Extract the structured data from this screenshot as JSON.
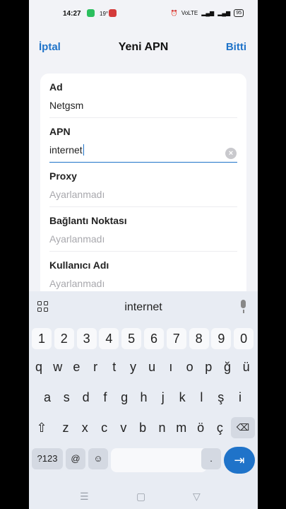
{
  "status_bar": {
    "time": "14:27",
    "temperature": "19°",
    "signal_text": "VoLTE",
    "battery": "95"
  },
  "nav": {
    "cancel_label": "İptal",
    "title": "Yeni APN",
    "done_label": "Bitti"
  },
  "fields": [
    {
      "label": "Ad",
      "value": "Netgsm",
      "placeholder": false
    },
    {
      "label": "APN",
      "value": "internet",
      "placeholder": false,
      "active": true
    },
    {
      "label": "Proxy",
      "value": "Ayarlanmadı",
      "placeholder": true
    },
    {
      "label": "Bağlantı Noktası",
      "value": "Ayarlanmadı",
      "placeholder": true
    },
    {
      "label": "Kullanıcı Adı",
      "value": "Ayarlanmadı",
      "placeholder": true
    }
  ],
  "keyboard": {
    "suggestion": "internet",
    "row_numbers": [
      "1",
      "2",
      "3",
      "4",
      "5",
      "6",
      "7",
      "8",
      "9",
      "0"
    ],
    "row1": [
      "q",
      "w",
      "e",
      "r",
      "t",
      "y",
      "u",
      "ı",
      "o",
      "p",
      "ğ",
      "ü"
    ],
    "row2": [
      "a",
      "s",
      "d",
      "f",
      "g",
      "h",
      "j",
      "k",
      "l",
      "ş",
      "i"
    ],
    "row3": [
      "z",
      "x",
      "c",
      "v",
      "b",
      "n",
      "m",
      "ö",
      "ç"
    ],
    "symbols_label": "?123",
    "at_label": "@",
    "period_label": ".",
    "enter_icon": "enter-arrow-icon"
  },
  "colors": {
    "accent": "#1f73c9",
    "background": "#f2f3f7",
    "keyboard": "#e8ecf3"
  }
}
